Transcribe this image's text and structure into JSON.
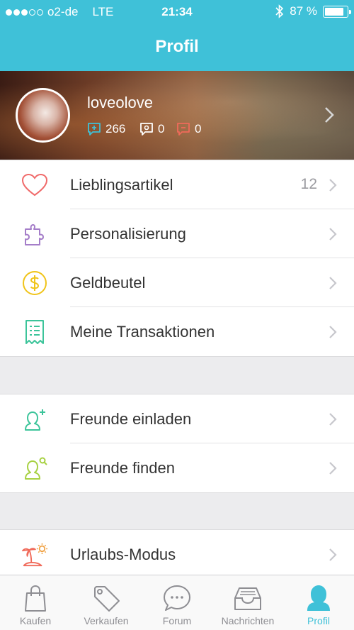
{
  "status_bar": {
    "carrier": "o2-de",
    "network": "LTE",
    "time": "21:34",
    "battery": "87 %",
    "battery_level": 0.87
  },
  "nav": {
    "title": "Profil"
  },
  "profile": {
    "username": "loveolove",
    "stats": [
      {
        "icon": "comment-plus-icon",
        "value": "266",
        "color": "#3fc1d8"
      },
      {
        "icon": "comment-neutral-icon",
        "value": "0",
        "color": "#ffffff"
      },
      {
        "icon": "comment-minus-icon",
        "value": "0",
        "color": "#f06a5a"
      }
    ]
  },
  "menu_group_1": {
    "items": [
      {
        "label": "Lieblingsartikel",
        "icon": "heart-icon",
        "count": "12",
        "color": "#f06a6a"
      },
      {
        "label": "Personalisierung",
        "icon": "puzzle-icon",
        "count": "",
        "color": "#a57ec9"
      },
      {
        "label": "Geldbeutel",
        "icon": "dollar-coin-icon",
        "count": "",
        "color": "#f0c419"
      },
      {
        "label": "Meine Transaktionen",
        "icon": "receipt-icon",
        "count": "",
        "color": "#3cc49a"
      }
    ]
  },
  "menu_group_2": {
    "items": [
      {
        "label": "Freunde einladen",
        "icon": "add-friend-icon",
        "color": "#3cc49a"
      },
      {
        "label": "Freunde finden",
        "icon": "find-friend-icon",
        "color": "#a7d142"
      }
    ]
  },
  "menu_group_3": {
    "items": [
      {
        "label": "Urlaubs-Modus",
        "icon": "island-sun-icon",
        "color": "#f06a5a"
      }
    ]
  },
  "tab_bar": {
    "active": "Profil",
    "tabs": [
      {
        "label": "Kaufen",
        "icon": "shopping-bag-icon"
      },
      {
        "label": "Verkaufen",
        "icon": "price-tag-icon"
      },
      {
        "label": "Forum",
        "icon": "chat-bubble-icon"
      },
      {
        "label": "Nachrichten",
        "icon": "inbox-tray-icon"
      },
      {
        "label": "Profil",
        "icon": "person-icon"
      }
    ]
  },
  "colors": {
    "accent": "#3fc1d8",
    "chevron": "#c7c7cc"
  }
}
